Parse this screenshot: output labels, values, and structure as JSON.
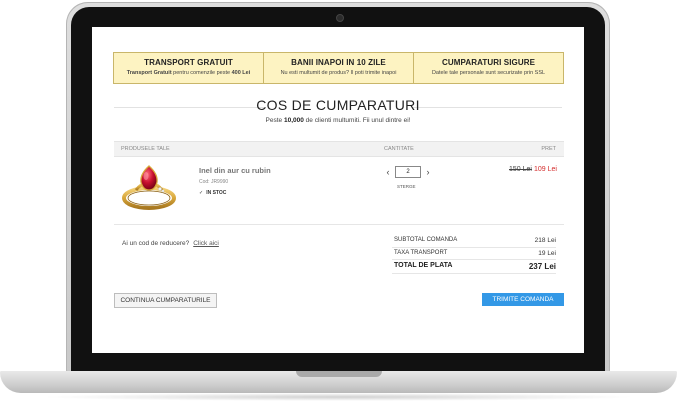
{
  "banners": [
    {
      "title": "TRANSPORT GRATUIT",
      "sub_bold_a": "Transport Gratuit",
      "sub_text": " pentru comenzile peste ",
      "sub_bold_b": "400 Lei"
    },
    {
      "title": "BANII INAPOI IN 10 ZILE",
      "sub": "Nu esti multumit de produs? Il poti trimite inapoi"
    },
    {
      "title": "CUMPARATURI SIGURE",
      "sub": "Datele tale personale sunt securizate prin SSL"
    }
  ],
  "page": {
    "title": "COS DE CUMPARATURI",
    "subtitle_pre": "Peste ",
    "subtitle_bold": "10,000",
    "subtitle_post": " de clienti multumiti. Fii unul dintre ei!"
  },
  "table": {
    "col_products": "PRODUSELE TALE",
    "col_quantity": "CANTITATE",
    "col_price": "PRET"
  },
  "product": {
    "name": "Inel din aur cu rubin",
    "code": "Cod: JR9990",
    "stock": "IN STOC",
    "quantity": "2",
    "remove": "STERGE",
    "old_price": "150 Lei",
    "new_price": "109 Lei"
  },
  "discount": {
    "question": "Ai un cod de reducere?",
    "link": "Click aici"
  },
  "summary": {
    "subtotal_label": "SUBTOTAL COMANDA",
    "subtotal_value": "218 Lei",
    "shipping_label": "TAXA TRANSPORT",
    "shipping_value": "19 Lei",
    "total_label": "TOTAL DE PLATA",
    "total_value": "237 Lei"
  },
  "buttons": {
    "continue": "CONTINUA CUMPARATURILE",
    "submit": "TRIMITE COMANDA"
  },
  "colors": {
    "banner_bg": "#fdf3c2",
    "accent_blue": "#3398e6",
    "sale_red": "#d42d2d"
  },
  "icons": {
    "qty_decrease": "chevron-left-icon",
    "qty_increase": "chevron-right-icon",
    "stock": "check-icon",
    "product": "ruby-ring-image"
  }
}
